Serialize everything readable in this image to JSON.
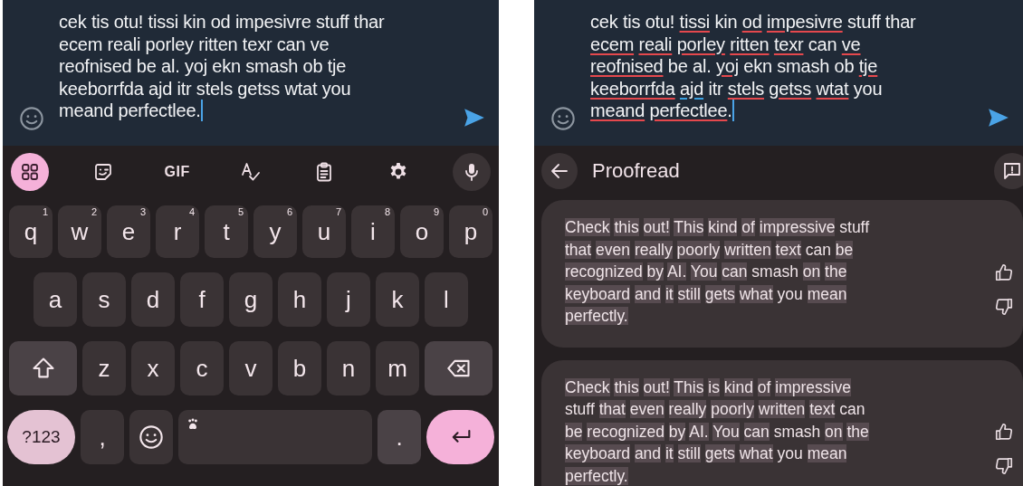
{
  "keyboard_screen": {
    "message_lines": [
      "cek tis otu! tissi kin od impesivre stuff thar",
      "ecem reali porley ritten texr can ve",
      "reofnised be al. yoj ekn smash ob tje",
      "keeborrfda ajd itr stels getss wtat you",
      "meand perfectlee."
    ],
    "toolbar": [
      {
        "kind": "apps",
        "selected": true
      },
      {
        "kind": "sticker",
        "selected": false
      },
      {
        "kind": "gif",
        "label": "GIF",
        "selected": false
      },
      {
        "kind": "spellcheck",
        "selected": false
      },
      {
        "kind": "clipboard",
        "selected": false
      },
      {
        "kind": "settings",
        "selected": false
      },
      {
        "kind": "mic",
        "selected": false
      }
    ],
    "key_rows": [
      [
        {
          "kind": "letter",
          "label": "q",
          "hint": "1"
        },
        {
          "kind": "letter",
          "label": "w",
          "hint": "2"
        },
        {
          "kind": "letter",
          "label": "e",
          "hint": "3"
        },
        {
          "kind": "letter",
          "label": "r",
          "hint": "4"
        },
        {
          "kind": "letter",
          "label": "t",
          "hint": "5"
        },
        {
          "kind": "letter",
          "label": "y",
          "hint": "6"
        },
        {
          "kind": "letter",
          "label": "u",
          "hint": "7"
        },
        {
          "kind": "letter",
          "label": "i",
          "hint": "8"
        },
        {
          "kind": "letter",
          "label": "o",
          "hint": "9"
        },
        {
          "kind": "letter",
          "label": "p",
          "hint": "0"
        }
      ],
      [
        {
          "kind": "letter",
          "label": "a"
        },
        {
          "kind": "letter",
          "label": "s"
        },
        {
          "kind": "letter",
          "label": "d"
        },
        {
          "kind": "letter",
          "label": "f"
        },
        {
          "kind": "letter",
          "label": "g"
        },
        {
          "kind": "letter",
          "label": "h"
        },
        {
          "kind": "letter",
          "label": "j"
        },
        {
          "kind": "letter",
          "label": "k"
        },
        {
          "kind": "letter",
          "label": "l"
        }
      ],
      [
        {
          "kind": "shift"
        },
        {
          "kind": "letter",
          "label": "z"
        },
        {
          "kind": "letter",
          "label": "x"
        },
        {
          "kind": "letter",
          "label": "c"
        },
        {
          "kind": "letter",
          "label": "v"
        },
        {
          "kind": "letter",
          "label": "b"
        },
        {
          "kind": "letter",
          "label": "n"
        },
        {
          "kind": "letter",
          "label": "m"
        },
        {
          "kind": "backspace"
        }
      ],
      [
        {
          "kind": "symbols",
          "label": "?123"
        },
        {
          "kind": "punct",
          "label": ","
        },
        {
          "kind": "emoji"
        },
        {
          "kind": "space"
        },
        {
          "kind": "punct",
          "label": "."
        },
        {
          "kind": "enter"
        }
      ]
    ]
  },
  "proofread_screen": {
    "message_lines": [
      [
        {
          "text": "cek tis otu!",
          "underlined": false
        },
        {
          "text": "tissi",
          "underlined": true,
          "color": "#e5484d"
        },
        {
          "text": "kin",
          "underlined": false
        },
        {
          "text": "od",
          "underlined": true,
          "color": "#e5484d"
        },
        {
          "text": "impesivre",
          "underlined": true,
          "color": "#e5484d"
        },
        {
          "text": "stuff thar",
          "underlined": false
        }
      ],
      [
        {
          "text": "ecem",
          "underlined": true,
          "color": "#e5484d"
        },
        {
          "text": "reali",
          "underlined": true,
          "color": "#e5484d"
        },
        {
          "text": "porley",
          "underlined": true,
          "color": "#e5484d"
        },
        {
          "text": "ritten",
          "underlined": true,
          "color": "#e5484d"
        },
        {
          "text": "texr",
          "underlined": true,
          "color": "#e5484d"
        },
        {
          "text": "can",
          "underlined": false
        },
        {
          "text": "ve",
          "underlined": true,
          "color": "#e5484d"
        }
      ],
      [
        {
          "text": "reofnised",
          "underlined": true,
          "color": "#e5484d"
        },
        {
          "text": "be al.",
          "underlined": false
        },
        {
          "text": "yoj",
          "underlined": true,
          "color": "#e5484d"
        },
        {
          "text": "ekn smash ob",
          "underlined": false
        },
        {
          "text": "tje",
          "underlined": true,
          "color": "#e5484d"
        }
      ],
      [
        {
          "text": "keeborrfda",
          "underlined": true,
          "color": "#e5484d"
        },
        {
          "text": "ajd",
          "underlined": true,
          "color": "#3aa0e0"
        },
        {
          "text": "itr",
          "underlined": false
        },
        {
          "text": "stels",
          "underlined": true,
          "color": "#e5484d"
        },
        {
          "text": "getss",
          "underlined": true,
          "color": "#e5484d"
        },
        {
          "text": "wtat",
          "underlined": true,
          "color": "#e5484d"
        },
        {
          "text": "you",
          "underlined": false
        }
      ],
      [
        {
          "text": "meand",
          "underlined": true,
          "color": "#e5484d"
        },
        {
          "text": "perfectlee",
          "underlined": true,
          "color": "#e5484d"
        },
        {
          "text": ".",
          "underlined": false
        }
      ]
    ],
    "header": {
      "title": "Proofread"
    },
    "suggestions": [
      {
        "lines": [
          [
            {
              "text": "Check this out! This kind of impressive",
              "highlighted": true
            },
            {
              "text": "stuff",
              "highlighted": false
            }
          ],
          [
            {
              "text": "that even really poorly written text",
              "highlighted": true
            },
            {
              "text": "can",
              "highlighted": false
            },
            {
              "text": "be",
              "highlighted": true
            }
          ],
          [
            {
              "text": "recognized by AI. You can",
              "highlighted": true
            },
            {
              "text": "smash",
              "highlighted": false
            },
            {
              "text": "on the",
              "highlighted": true
            }
          ],
          [
            {
              "text": "keyboard and it still gets what",
              "highlighted": true
            },
            {
              "text": "you",
              "highlighted": false
            },
            {
              "text": "mean",
              "highlighted": true
            }
          ],
          [
            {
              "text": "perfectly.",
              "highlighted": true
            }
          ]
        ]
      },
      {
        "lines": [
          [
            {
              "text": "Check this out! This is kind of impressive",
              "highlighted": true
            }
          ],
          [
            {
              "text": "stuff",
              "highlighted": false
            },
            {
              "text": "that even really poorly written text",
              "highlighted": true
            },
            {
              "text": "can",
              "highlighted": false
            }
          ],
          [
            {
              "text": "be recognized by AI. You can",
              "highlighted": true
            },
            {
              "text": "smash",
              "highlighted": false
            },
            {
              "text": "on the",
              "highlighted": true
            }
          ],
          [
            {
              "text": "keyboard and it still gets what",
              "highlighted": true
            },
            {
              "text": "you",
              "highlighted": false
            },
            {
              "text": "mean",
              "highlighted": true
            }
          ],
          [
            {
              "text": "perfectly.",
              "highlighted": true
            }
          ]
        ]
      }
    ]
  }
}
